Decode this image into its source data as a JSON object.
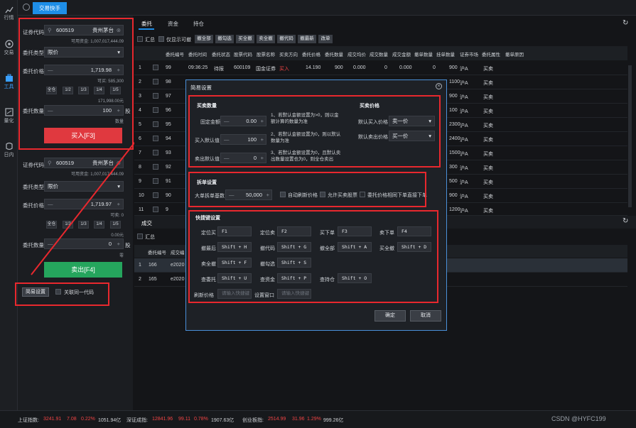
{
  "nav": {
    "items": [
      {
        "label": "行情",
        "icon": "chart-icon"
      },
      {
        "label": "交易",
        "icon": "trade-icon"
      },
      {
        "label": "工具",
        "icon": "toolbox-icon"
      },
      {
        "label": "量化",
        "icon": "quant-icon"
      },
      {
        "label": "日内",
        "icon": "intraday-icon"
      }
    ],
    "active": "工具"
  },
  "topbar": {
    "tab_label": "交易快手"
  },
  "buy_panel": {
    "code_label": "证券代码",
    "code_value": "600519",
    "name": "贵州茅台",
    "available_funds": "可用资金: 1,007,017,444.09",
    "order_type_label": "委托类型",
    "order_type_value": "限价",
    "price_label": "委托价格",
    "price_value": "1,719.98",
    "can_buy": "可买: 585,300",
    "qty_buttons": [
      "全仓",
      "1/2",
      "1/3",
      "1/4",
      "1/5"
    ],
    "amount_hint": "171,998.00元",
    "qty_label": "委托数量",
    "qty_value": "100",
    "qty_unit": "股",
    "suffix": "数量",
    "button_label": "买入[F3]"
  },
  "sell_panel": {
    "code_label": "证券代码",
    "code_value": "600519",
    "name": "贵州茅台",
    "available_funds": "可用资金: 1,007,017,444.09",
    "order_type_label": "委托类型",
    "order_type_value": "限价",
    "price_label": "委托价格",
    "price_value": "1,719.97",
    "can_sell": "可卖: 0",
    "qty_buttons": [
      "全仓",
      "1/2",
      "1/3",
      "1/4",
      "1/5"
    ],
    "amount_hint": "0.00元",
    "qty_label": "委托数量",
    "qty_value": "0",
    "qty_unit": "股",
    "suffix": "零",
    "button_label": "卖出[F4]"
  },
  "bottom_left": {
    "settings_button": "简易设置",
    "link_label": "关联同一代码"
  },
  "main_tabs": [
    "委托",
    "资金",
    "持仓"
  ],
  "toolbar": {
    "summary_label": "汇总",
    "only_cancellable_label": "仅显示可撤",
    "buttons": [
      "撤全部",
      "撤勾选",
      "买全撤",
      "卖全撤",
      "撤代码",
      "撤最新",
      "改单"
    ]
  },
  "orders_table": {
    "headers": [
      "委托编号",
      "委托时间",
      "委托状态",
      "股票代码",
      "股票名称",
      "买卖方向",
      "委托价格",
      "委托数量",
      "成交均价",
      "成交数量",
      "成交金额",
      "撤单数量",
      "挂单数量",
      "证券市场",
      "委托属性",
      "撤单原因"
    ],
    "rows": [
      {
        "idx": "1",
        "id": "99",
        "time": "09:36:25",
        "status": "待报",
        "code": "600109",
        "name": "国金证券",
        "dir": "买入",
        "price": "14.190",
        "qty": "900",
        "avg": "0.000",
        "fqty": "0",
        "famt": "0.000",
        "cqty": "0",
        "pqty": "900",
        "market": "沪A",
        "attr": "买卖"
      },
      {
        "idx": "2",
        "id": "98",
        "pqty": "1100",
        "market": "沪A",
        "attr": "买卖"
      },
      {
        "idx": "3",
        "id": "97",
        "pqty": "900",
        "market": "沪A",
        "attr": "买卖"
      },
      {
        "idx": "4",
        "id": "96",
        "pqty": "100",
        "market": "沪A",
        "attr": "买卖"
      },
      {
        "idx": "5",
        "id": "95",
        "pqty": "2300",
        "market": "沪A",
        "attr": "买卖"
      },
      {
        "idx": "6",
        "id": "94",
        "pqty": "2400",
        "market": "沪A",
        "attr": "买卖"
      },
      {
        "idx": "7",
        "id": "93",
        "pqty": "1500",
        "market": "沪A",
        "attr": "买卖"
      },
      {
        "idx": "8",
        "id": "92",
        "pqty": "300",
        "market": "沪A",
        "attr": "买卖"
      },
      {
        "idx": "9",
        "id": "91",
        "pqty": "500",
        "market": "沪A",
        "attr": "买卖"
      },
      {
        "idx": "10",
        "id": "90",
        "pqty": "900",
        "market": "沪A",
        "attr": "买卖"
      },
      {
        "idx": "11",
        "id": "9",
        "pqty": "1200",
        "market": "沪A",
        "attr": "买卖"
      }
    ]
  },
  "trades": {
    "tab": "成交",
    "summary_label": "汇总",
    "headers": [
      "委托编号",
      "成交编"
    ],
    "rows": [
      {
        "idx": "1",
        "id": "166",
        "trade_id": "e2020"
      },
      {
        "idx": "2",
        "id": "165",
        "trade_id": "e2020"
      }
    ]
  },
  "dialog": {
    "title": "简易设置",
    "qty_section": {
      "title": "买卖数量",
      "fixed_amount_label": "固定金额",
      "fixed_amount_value": "0.00",
      "buy_default_label": "买入默认值",
      "buy_default_value": "100",
      "sell_default_label": "卖出默认值",
      "sell_default_value": "0",
      "notes": [
        "1、若默认金额设置为>0，则以金额计算的数量为准",
        "2、若默认金额设置为0，则以默认数量为准",
        "3、若默认金额设置为0，且默认卖出数量设置也为0，则全仓卖出"
      ]
    },
    "price_section": {
      "title": "买卖价格",
      "buy_price_label": "默认买入价格",
      "buy_price_value": "卖一价",
      "sell_price_label": "默认卖出价格",
      "sell_price_value": "买一价"
    },
    "split_section": {
      "title": "拆单设置",
      "max_amount_label": "大单拆单基数",
      "max_amount_value": "50,000",
      "options": [
        "自动刷新价格",
        "允许买卖股票",
        "委托价格相同下单直接下单"
      ]
    },
    "hotkey_section": {
      "title": "快捷键设置",
      "keys": [
        {
          "label": "定位买",
          "key": "F1"
        },
        {
          "label": "定位卖",
          "key": "F2"
        },
        {
          "label": "买下单",
          "key": "F3"
        },
        {
          "label": "卖下单",
          "key": "F4"
        },
        {
          "label": "撤最后",
          "key": "Shift + H"
        },
        {
          "label": "撤代码",
          "key": "Shift + G"
        },
        {
          "label": "撤全部",
          "key": "Shift + A"
        },
        {
          "label": "买全撤",
          "key": "Shift + D"
        },
        {
          "label": "卖全撤",
          "key": "Shift + F"
        },
        {
          "label": "撤勾选",
          "key": "Shift + S"
        },
        {
          "label": "查委托",
          "key": "Shift + U"
        },
        {
          "label": "查资金",
          "key": "Shift + P"
        },
        {
          "label": "查持仓",
          "key": "Shift + O"
        },
        {
          "label": "刷新价格",
          "key": "请输入快捷键"
        },
        {
          "label": "设置窗口",
          "key": "请输入快捷键"
        }
      ]
    },
    "ok_button": "确定",
    "cancel_button": "取消"
  },
  "statusbar": {
    "sh_label": "上证指数:",
    "sh_value": "3241.91",
    "sh_change": "7.08",
    "sh_pct": "0.22%",
    "sh_amount": "1051.94亿",
    "sz_label": "深证成指:",
    "sz_value": "12841.96",
    "sz_change": "99.11",
    "sz_pct": "0.78%",
    "sz_amount": "1907.63亿",
    "cy_label": "创业板指:",
    "cy_value": "2514.99",
    "cy_change": "31.96",
    "cy_pct": "1.29%",
    "cy_amount": "999.26亿",
    "watermark": "CSDN @HYFC199"
  }
}
